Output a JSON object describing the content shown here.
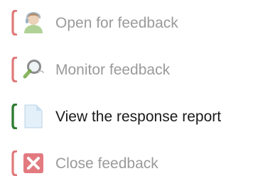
{
  "menu": {
    "items": [
      {
        "label": "Open for feedback",
        "icon": "user-icon",
        "state": "disabled",
        "accent": "#e0787a"
      },
      {
        "label": "Monitor feedback",
        "icon": "magnifier-icon",
        "state": "disabled",
        "accent": "#e0787a"
      },
      {
        "label": "View the response report",
        "icon": "document-icon",
        "state": "active",
        "accent": "#2f7d32"
      },
      {
        "label": "Close feedback",
        "icon": "close-box-icon",
        "state": "disabled",
        "accent": "#e0787a"
      }
    ]
  },
  "colors": {
    "disabled_text": "#9a9a9a",
    "active_text": "#1a1a1a",
    "disabled_accent": "#e0787a",
    "active_accent": "#2f7d32"
  }
}
